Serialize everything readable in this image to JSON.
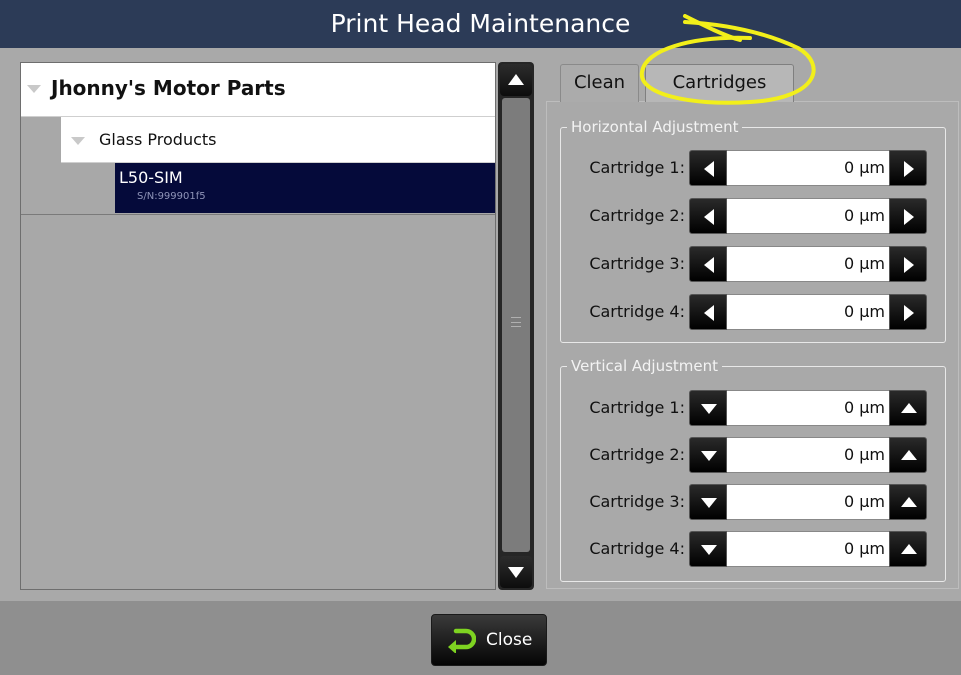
{
  "window": {
    "title": "Print Head Maintenance"
  },
  "tree": {
    "root": {
      "label": "Jhonny's Motor Parts"
    },
    "child": {
      "label": "Glass Products"
    },
    "leaf": {
      "name": "L50-SIM",
      "serial": "S/N:999901f5"
    }
  },
  "tabs": [
    {
      "label": "Clean"
    },
    {
      "label": "Cartridges"
    }
  ],
  "horizontal": {
    "legend": "Horizontal Adjustment",
    "rows": [
      {
        "label": "Cartridge 1:",
        "value": "0 µm"
      },
      {
        "label": "Cartridge 2:",
        "value": "0 µm"
      },
      {
        "label": "Cartridge 3:",
        "value": "0 µm"
      },
      {
        "label": "Cartridge 4:",
        "value": "0 µm"
      }
    ]
  },
  "vertical": {
    "legend": "Vertical Adjustment",
    "rows": [
      {
        "label": "Cartridge 1:",
        "value": "0 µm"
      },
      {
        "label": "Cartridge 2:",
        "value": "0 µm"
      },
      {
        "label": "Cartridge 3:",
        "value": "0 µm"
      },
      {
        "label": "Cartridge 4:",
        "value": "0 µm"
      }
    ]
  },
  "footer": {
    "close_label": "Close"
  },
  "colors": {
    "titlebar": "#2c3b57",
    "selection": "#050a3a",
    "close_icon": "#7ed321",
    "annotation": "#f2ef1a"
  }
}
